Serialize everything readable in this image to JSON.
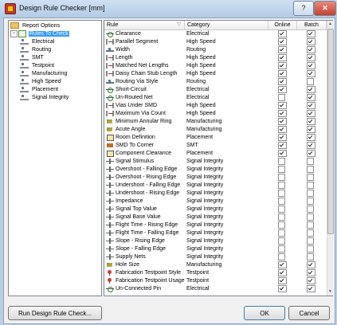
{
  "window": {
    "title": "Design Rule Checker [mm]",
    "help_label": "?",
    "close_label": "✕"
  },
  "tree": [
    {
      "label": "Report Options",
      "icon": "folder",
      "level": 0,
      "expander": "",
      "selected": false
    },
    {
      "label": "Rules To Check",
      "icon": "rules",
      "level": 0,
      "expander": "−",
      "selected": true
    },
    {
      "label": "Electrical",
      "icon": "electrical",
      "level": 1,
      "expander": "",
      "selected": false
    },
    {
      "label": "Routing",
      "icon": "routing",
      "level": 1,
      "expander": "",
      "selected": false
    },
    {
      "label": "SMT",
      "icon": "smt",
      "level": 1,
      "expander": "",
      "selected": false
    },
    {
      "label": "Testpoint",
      "icon": "testpoint",
      "level": 1,
      "expander": "",
      "selected": false
    },
    {
      "label": "Manufacturing",
      "icon": "manufacturing",
      "level": 1,
      "expander": "",
      "selected": false
    },
    {
      "label": "High Speed",
      "icon": "high-speed",
      "level": 1,
      "expander": "",
      "selected": false
    },
    {
      "label": "Placement",
      "icon": "placement",
      "level": 1,
      "expander": "",
      "selected": false
    },
    {
      "label": "Signal Integrity",
      "icon": "signal-integrity",
      "level": 1,
      "expander": "",
      "selected": false
    }
  ],
  "table": {
    "columns": [
      "Rule",
      "Category",
      "Online",
      "Batch"
    ],
    "sort_indicator": "▽",
    "rows": [
      {
        "rule": "Clearance",
        "category": "Electrical",
        "online": true,
        "batch": true,
        "icon": "electrical"
      },
      {
        "rule": "Parallel Segment",
        "category": "High Speed",
        "online": true,
        "batch": true,
        "icon": "high-speed"
      },
      {
        "rule": "Width",
        "category": "Routing",
        "online": true,
        "batch": true,
        "icon": "routing"
      },
      {
        "rule": "Length",
        "category": "High Speed",
        "online": true,
        "batch": true,
        "icon": "high-speed"
      },
      {
        "rule": "Matched Net Lengths",
        "category": "High Speed",
        "online": true,
        "batch": true,
        "icon": "high-speed"
      },
      {
        "rule": "Daisy Chain Stub Length",
        "category": "High Speed",
        "online": true,
        "batch": true,
        "icon": "high-speed"
      },
      {
        "rule": "Routing Via Style",
        "category": "Routing",
        "online": true,
        "batch": false,
        "icon": "routing"
      },
      {
        "rule": "Short-Circuit",
        "category": "Electrical",
        "online": true,
        "batch": true,
        "icon": "electrical"
      },
      {
        "rule": "Un-Routed Net",
        "category": "Electrical",
        "online": false,
        "batch": true,
        "icon": "electrical"
      },
      {
        "rule": "Vias Under SMD",
        "category": "High Speed",
        "online": true,
        "batch": true,
        "icon": "high-speed"
      },
      {
        "rule": "Maximum Via Count",
        "category": "High Speed",
        "online": true,
        "batch": true,
        "icon": "high-speed"
      },
      {
        "rule": "Minimum Annular Ring",
        "category": "Manufacturing",
        "online": true,
        "batch": true,
        "icon": "manufacturing"
      },
      {
        "rule": "Acute Angle",
        "category": "Manufacturing",
        "online": true,
        "batch": true,
        "icon": "manufacturing"
      },
      {
        "rule": "Room Definition",
        "category": "Placement",
        "online": true,
        "batch": true,
        "icon": "placement"
      },
      {
        "rule": "SMD To Corner",
        "category": "SMT",
        "online": true,
        "batch": true,
        "icon": "smt"
      },
      {
        "rule": "Component Clearance",
        "category": "Placement",
        "online": true,
        "batch": true,
        "icon": "placement"
      },
      {
        "rule": "Signal Stimulus",
        "category": "Signal Integrity",
        "online": false,
        "batch": false,
        "icon": "signal-integrity"
      },
      {
        "rule": "Overshoot - Falling Edge",
        "category": "Signal Integrity",
        "online": false,
        "batch": false,
        "icon": "signal-integrity"
      },
      {
        "rule": "Overshoot - Rising Edge",
        "category": "Signal Integrity",
        "online": false,
        "batch": false,
        "icon": "signal-integrity"
      },
      {
        "rule": "Undershoot - Falling Edge",
        "category": "Signal Integrity",
        "online": false,
        "batch": false,
        "icon": "signal-integrity"
      },
      {
        "rule": "Undershoot - Rising Edge",
        "category": "Signal Integrity",
        "online": false,
        "batch": false,
        "icon": "signal-integrity"
      },
      {
        "rule": "Impedance",
        "category": "Signal Integrity",
        "online": false,
        "batch": false,
        "icon": "signal-integrity"
      },
      {
        "rule": "Signal Top Value",
        "category": "Signal Integrity",
        "online": false,
        "batch": false,
        "icon": "signal-integrity"
      },
      {
        "rule": "Signal Base Value",
        "category": "Signal Integrity",
        "online": false,
        "batch": false,
        "icon": "signal-integrity"
      },
      {
        "rule": "Flight Time - Rising Edge",
        "category": "Signal Integrity",
        "online": false,
        "batch": false,
        "icon": "signal-integrity"
      },
      {
        "rule": "Flight Time - Falling Edge",
        "category": "Signal Integrity",
        "online": false,
        "batch": false,
        "icon": "signal-integrity"
      },
      {
        "rule": "Slope - Rising Edge",
        "category": "Signal Integrity",
        "online": false,
        "batch": false,
        "icon": "signal-integrity"
      },
      {
        "rule": "Slope - Falling Edge",
        "category": "Signal Integrity",
        "online": false,
        "batch": false,
        "icon": "signal-integrity"
      },
      {
        "rule": "Supply Nets",
        "category": "Signal Integrity",
        "online": false,
        "batch": false,
        "icon": "signal-integrity"
      },
      {
        "rule": "Hole Size",
        "category": "Manufacturing",
        "online": true,
        "batch": true,
        "icon": "manufacturing"
      },
      {
        "rule": "Fabrication Testpoint Style",
        "category": "Testpoint",
        "online": true,
        "batch": true,
        "icon": "testpoint"
      },
      {
        "rule": "Fabrication Testpoint Usage",
        "category": "Testpoint",
        "online": true,
        "batch": true,
        "icon": "testpoint"
      },
      {
        "rule": "Un-Connected Pin",
        "category": "Electrical",
        "online": true,
        "batch": true,
        "icon": "electrical"
      }
    ]
  },
  "buttons": {
    "run_label": "Run Design Rule Check...",
    "ok_label": "OK",
    "cancel_label": "Cancel"
  }
}
